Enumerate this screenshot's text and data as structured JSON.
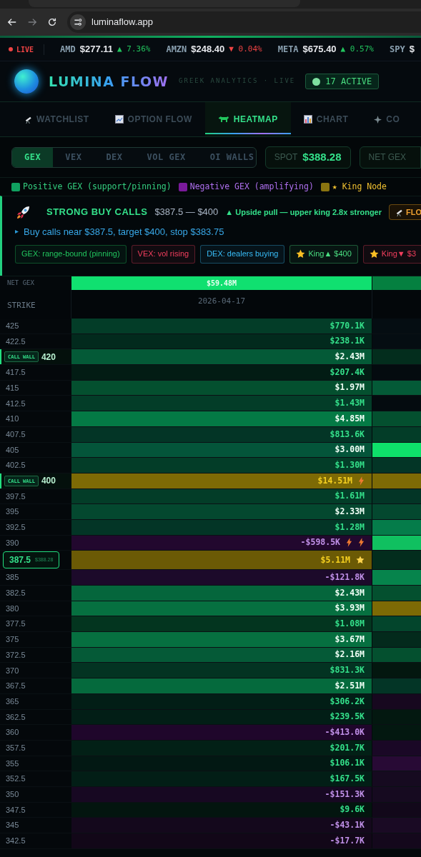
{
  "browser": {
    "url": "luminaflow.app"
  },
  "ticker": {
    "live_label": "LIVE",
    "items": [
      {
        "symbol": "AMD",
        "price": "$277.11",
        "change": "▲ 7.36%",
        "kind": "up"
      },
      {
        "symbol": "AMZN",
        "price": "$248.40",
        "change": "▼ 0.04%",
        "kind": "down"
      },
      {
        "symbol": "META",
        "price": "$675.40",
        "change": "▲ 0.57%",
        "kind": "up"
      },
      {
        "symbol": "SPY",
        "price": "$"
      }
    ]
  },
  "header": {
    "brand": "LUMINA FLOW",
    "tagline": "GREEK ANALYTICS · LIVE",
    "active_badge": "17 ACTIVE"
  },
  "tabs": [
    {
      "label": "WATCHLIST",
      "selected": false
    },
    {
      "label": "OPTION FLOW",
      "selected": false
    },
    {
      "label": "HEATMAP",
      "selected": true
    },
    {
      "label": "CHART",
      "selected": false
    },
    {
      "label": "CO",
      "selected": false
    }
  ],
  "modes": [
    {
      "label": "GEX",
      "selected": true
    },
    {
      "label": "VEX",
      "selected": false
    },
    {
      "label": "DEX",
      "selected": false
    },
    {
      "label": "VOL GEX",
      "selected": false
    },
    {
      "label": "OI WALLS",
      "selected": false
    }
  ],
  "spot": {
    "label": "SPOT",
    "value": "$388.28"
  },
  "net_gex_box": {
    "label": "NET GEX"
  },
  "legend": [
    {
      "label": "Positive GEX (support/pinning)",
      "color": "#10a060"
    },
    {
      "label": "Negative GEX (amplifying)",
      "color": "#7a1a9a"
    },
    {
      "label": "★ King Node",
      "color": "#8a7410"
    }
  ],
  "signal": {
    "title": "STRONG BUY CALLS",
    "range": "$387.5 — $400",
    "pull": "▲ Upside pull — upper king 2.8x stronger",
    "chip": "FLO",
    "advice": "Buy calls near $387.5, target $400, stop $383.75",
    "tags": [
      {
        "kind": "plain",
        "label": "GEX: range-bound (pinning)",
        "color": "#22c55e"
      },
      {
        "kind": "plain",
        "label": "VEX: vol rising",
        "color": "#f43f5e"
      },
      {
        "kind": "plain",
        "label": "DEX: dealers buying",
        "color": "#38bdf8"
      },
      {
        "kind": "king",
        "label": "King▲ $400",
        "color": "#4ade80"
      },
      {
        "kind": "king",
        "label": "King▼ $3",
        "color": "#f43f5e"
      }
    ]
  },
  "table": {
    "net_label": "NET GEX",
    "net_value": "$59.48M",
    "strike_header": "STRIKE",
    "expiry": "2026-04-17",
    "rows": [
      {
        "strike": "425",
        "kind": "plain",
        "cell": {
          "kind": "pos",
          "value": "$770.1K",
          "color": "#033d28"
        },
        "next_cell": {
          "color": "#050d12"
        }
      },
      {
        "strike": "422.5",
        "kind": "plain",
        "cell": {
          "kind": "pos",
          "value": "$238.1K",
          "color": "#022a1d"
        },
        "next_cell": {
          "color": "#050d12"
        }
      },
      {
        "strike": "420",
        "kind": "wall",
        "badge": "CALL WALL",
        "cell": {
          "kind": "strong",
          "value": "$2.43M",
          "color": "#045a37"
        },
        "next_cell": {
          "color": "#032d1d"
        }
      },
      {
        "strike": "417.5",
        "kind": "plain",
        "cell": {
          "kind": "pos",
          "value": "$207.4K",
          "color": "#021c14"
        },
        "next_cell": {
          "color": "#040b0f"
        }
      },
      {
        "strike": "415",
        "kind": "plain",
        "cell": {
          "kind": "strong",
          "value": "$1.97M",
          "color": "#04502f"
        },
        "next_cell": {
          "color": "#045a37"
        }
      },
      {
        "strike": "412.5",
        "kind": "plain",
        "cell": {
          "kind": "pos",
          "value": "$1.43M",
          "color": "#033d28"
        },
        "next_cell": {
          "color": "#040b0f"
        }
      },
      {
        "strike": "410",
        "kind": "plain",
        "cell": {
          "kind": "strong",
          "value": "$4.85M",
          "color": "#047a45"
        },
        "next_cell": {
          "color": "#04502f"
        }
      },
      {
        "strike": "407.5",
        "kind": "plain",
        "cell": {
          "kind": "pos",
          "value": "$813.6K",
          "color": "#033526"
        },
        "next_cell": {
          "color": "#033d28"
        }
      },
      {
        "strike": "405",
        "kind": "plain",
        "cell": {
          "kind": "strong",
          "value": "$3.00M",
          "color": "#04553a"
        },
        "next_cell": {
          "color": "#0ee06a"
        }
      },
      {
        "strike": "402.5",
        "kind": "plain",
        "cell": {
          "kind": "pos",
          "value": "$1.30M",
          "color": "#033d28"
        },
        "next_cell": {
          "color": "#033526"
        }
      },
      {
        "strike": "400",
        "kind": "wall",
        "badge": "CALL WALL",
        "cell": {
          "kind": "king",
          "value": "$14.51M",
          "color": "#7d6a05",
          "marks": [
            {
              "kind": "bolt"
            }
          ]
        },
        "next_cell": {
          "color": "#7d6a05"
        }
      },
      {
        "strike": "397.5",
        "kind": "plain",
        "cell": {
          "kind": "pos",
          "value": "$1.61M",
          "color": "#033d28"
        },
        "next_cell": {
          "color": "#033526"
        }
      },
      {
        "strike": "395",
        "kind": "plain",
        "cell": {
          "kind": "strong",
          "value": "$2.33M",
          "color": "#04482f"
        },
        "next_cell": {
          "color": "#04482f"
        }
      },
      {
        "strike": "392.5",
        "kind": "plain",
        "cell": {
          "kind": "pos",
          "value": "$1.28M",
          "color": "#033526"
        },
        "next_cell": {
          "color": "#057c4a"
        }
      },
      {
        "strike": "390",
        "kind": "plain",
        "cell": {
          "kind": "neg",
          "value": "-$598.5K",
          "color": "#22082e",
          "marks": [
            {
              "kind": "bolt"
            },
            {
              "kind": "bolt"
            }
          ]
        },
        "next_cell": {
          "color": "#10c060"
        }
      },
      {
        "strike": "387.5",
        "kind": "spot",
        "spot": "$388.28",
        "cell": {
          "kind": "king",
          "value": "$5.11M",
          "color": "#6b5a05",
          "marks": [
            {
              "kind": "star"
            }
          ]
        },
        "next_cell": {
          "color": "#032d1d"
        }
      },
      {
        "strike": "385",
        "kind": "plain",
        "cell": {
          "kind": "neg",
          "value": "-$121.8K",
          "color": "#1c0a2a"
        },
        "next_cell": {
          "color": "#06844c"
        }
      },
      {
        "strike": "382.5",
        "kind": "plain",
        "cell": {
          "kind": "strong",
          "value": "$2.43M",
          "color": "#05663c"
        },
        "next_cell": {
          "color": "#04502f"
        }
      },
      {
        "strike": "380",
        "kind": "plain",
        "cell": {
          "kind": "strong",
          "value": "$3.93M",
          "color": "#067040"
        },
        "next_cell": {
          "color": "#7d6a05"
        }
      },
      {
        "strike": "377.5",
        "kind": "plain",
        "cell": {
          "kind": "pos",
          "value": "$1.08M",
          "color": "#03351f"
        },
        "next_cell": {
          "color": "#03452c"
        }
      },
      {
        "strike": "375",
        "kind": "plain",
        "cell": {
          "kind": "strong",
          "value": "$3.67M",
          "color": "#067040"
        },
        "next_cell": {
          "color": "#032a1c"
        }
      },
      {
        "strike": "372.5",
        "kind": "plain",
        "cell": {
          "kind": "strong",
          "value": "$2.16M",
          "color": "#055a37"
        },
        "next_cell": {
          "color": "#04502f"
        }
      },
      {
        "strike": "370",
        "kind": "plain",
        "cell": {
          "kind": "pos",
          "value": "$831.3K",
          "color": "#033322"
        },
        "next_cell": {
          "color": "#03170f"
        }
      },
      {
        "strike": "367.5",
        "kind": "plain",
        "cell": {
          "kind": "strong",
          "value": "$2.51M",
          "color": "#056a3d"
        },
        "next_cell": {
          "color": "#033526"
        }
      },
      {
        "strike": "365",
        "kind": "plain",
        "cell": {
          "kind": "pos",
          "value": "$306.2K",
          "color": "#021e16"
        },
        "next_cell": {
          "color": "#17081f"
        }
      },
      {
        "strike": "362.5",
        "kind": "plain",
        "cell": {
          "kind": "pos",
          "value": "$239.5K",
          "color": "#021e16"
        },
        "next_cell": {
          "color": "#031810"
        }
      },
      {
        "strike": "360",
        "kind": "plain",
        "cell": {
          "kind": "neg",
          "value": "-$413.0K",
          "color": "#1f062b"
        },
        "next_cell": {
          "color": "#031810"
        }
      },
      {
        "strike": "357.5",
        "kind": "plain",
        "cell": {
          "kind": "pos",
          "value": "$201.7K",
          "color": "#022016"
        },
        "next_cell": {
          "color": "#1a0826"
        }
      },
      {
        "strike": "355",
        "kind": "plain",
        "cell": {
          "kind": "pos",
          "value": "$106.1K",
          "color": "#021813"
        },
        "next_cell": {
          "color": "#280a35"
        }
      },
      {
        "strike": "352.5",
        "kind": "plain",
        "cell": {
          "kind": "pos",
          "value": "$167.5K",
          "color": "#021e16"
        },
        "next_cell": {
          "color": "#160a20"
        }
      },
      {
        "strike": "350",
        "kind": "plain",
        "cell": {
          "kind": "neg",
          "value": "-$151.3K",
          "color": "#170822"
        },
        "next_cell": {
          "color": "#160a20"
        }
      },
      {
        "strike": "347.5",
        "kind": "plain",
        "cell": {
          "kind": "pos",
          "value": "$9.6K",
          "color": "#03150f"
        },
        "next_cell": {
          "color": "#12081a"
        }
      },
      {
        "strike": "345",
        "kind": "plain",
        "cell": {
          "kind": "neg",
          "value": "-$43.1K",
          "color": "#14081c"
        },
        "next_cell": {
          "color": "#1a0a24"
        }
      },
      {
        "strike": "342.5",
        "kind": "plain",
        "cell": {
          "kind": "neg",
          "value": "-$17.7K",
          "color": "#120718"
        },
        "next_cell": {
          "color": "#14081c"
        }
      }
    ]
  }
}
